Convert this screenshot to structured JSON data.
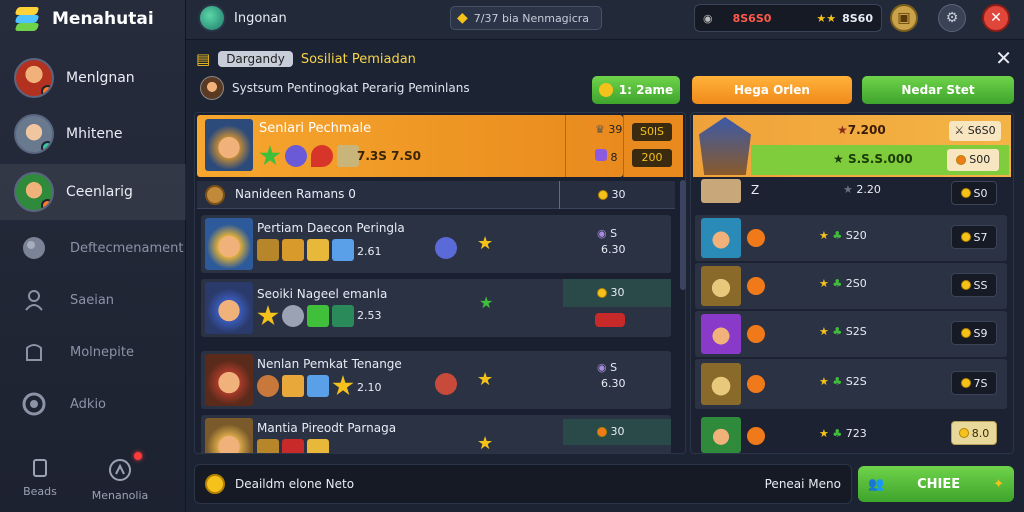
{
  "app": {
    "title": "Menahutai"
  },
  "sidebar": {
    "items": [
      {
        "label": "Menlgnan"
      },
      {
        "label": "Mhitene"
      },
      {
        "label": "Ceenlarig"
      }
    ],
    "muted": [
      {
        "label": "Deftecmenament"
      },
      {
        "label": "Saeian"
      },
      {
        "label": "Molnepite"
      },
      {
        "label": "Adkio"
      }
    ],
    "bottom": [
      {
        "label": "Beads"
      },
      {
        "label": "Menanolia"
      }
    ]
  },
  "topbar": {
    "region": "Ingonan",
    "search_text": "7/37 bia Nenmagicra",
    "resource_left": "8S6S0",
    "resource_right": "8S60"
  },
  "panel": {
    "tag": "Dargandy",
    "title": "Sosiliat Pemiadan",
    "subtitle": "Systsum Pentinogkat Perarig Peminlans",
    "timer_btn": "1: 2ame",
    "orange_btn": "Hega Orlen",
    "green_btn": "Nedar Stet"
  },
  "featured": {
    "name": "Senlari Pechmale",
    "price": "7.3S 7.S0",
    "stat1": "39",
    "stat1_badge": "S0lS",
    "stat2": "8",
    "stat2_badge": "200"
  },
  "list_header": {
    "label": "Nanideen Ramans 0",
    "cost": "30"
  },
  "rows": [
    {
      "name": "Pertiam Daecon Peringla",
      "value": "2.61",
      "side_top": "S",
      "side_bottom": "6.30",
      "cost": ""
    },
    {
      "name": "Seoiki Nageel emanla",
      "value": "2.53",
      "side_top": "",
      "side_bottom": "",
      "cost": "30"
    },
    {
      "name": "Nenlan Pemkat Tenange",
      "value": "2.10",
      "side_top": "S",
      "side_bottom": "6.30",
      "cost": ""
    },
    {
      "name": "Mantia Pireodt Parnaga",
      "value": "",
      "side_top": "",
      "side_bottom": "",
      "cost": "30"
    }
  ],
  "right": {
    "head_top": "7.200",
    "head_top_badge": "S6S0",
    "head_bottom": "S.S.S.000",
    "head_bottom_badge": "S00",
    "rows": [
      {
        "count": "Z",
        "value": "2.20",
        "cost": "S0"
      },
      {
        "count": "",
        "value": "S20",
        "cost": "S7"
      },
      {
        "count": "",
        "value": "2S0",
        "cost": "SS"
      },
      {
        "count": "",
        "value": "S2S",
        "cost": "S9"
      },
      {
        "count": "",
        "value": "S2S",
        "cost": "7S"
      },
      {
        "count": "",
        "value": "723",
        "cost": "8.0"
      }
    ]
  },
  "footer": {
    "left_label": "Deaildm elone Neto",
    "right_label": "Peneai Meno",
    "cta": "CHIEE"
  }
}
